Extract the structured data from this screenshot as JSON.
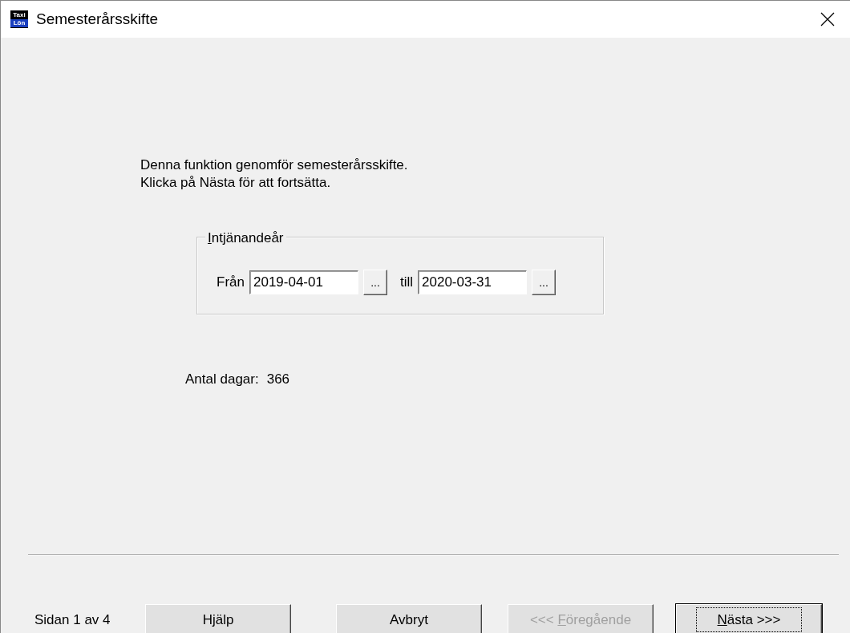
{
  "window": {
    "title": "Semesterårsskifte",
    "app_icon": {
      "line_1": "Taxi",
      "line_2": "Lön"
    }
  },
  "intro": [
    "Denna funktion genomför semesterårsskifte.",
    "Klicka på Nästa för att fortsätta."
  ],
  "group": {
    "title": "Intjänandeår",
    "underlined_initial": true,
    "from": {
      "label": "Från",
      "value": "2019-04-01",
      "button": "..."
    },
    "to": {
      "label": "till",
      "value": "2020-03-31",
      "button": "..."
    }
  },
  "days": {
    "label": "Antal dagar:",
    "value": "366"
  },
  "footer": {
    "page": "Sidan 1 av 4",
    "buttons": [
      {
        "label": "Hjälp",
        "disabled": false,
        "default": false,
        "underlined_initial": false
      },
      {
        "label": "Avbryt",
        "disabled": false,
        "default": false,
        "underlined_initial": false
      },
      {
        "label": "<<< Föregående",
        "disabled": true,
        "default": false,
        "underlined_initial": true
      },
      {
        "label": "Nästa >>>",
        "disabled": false,
        "default": true,
        "underlined_initial": true
      }
    ]
  }
}
